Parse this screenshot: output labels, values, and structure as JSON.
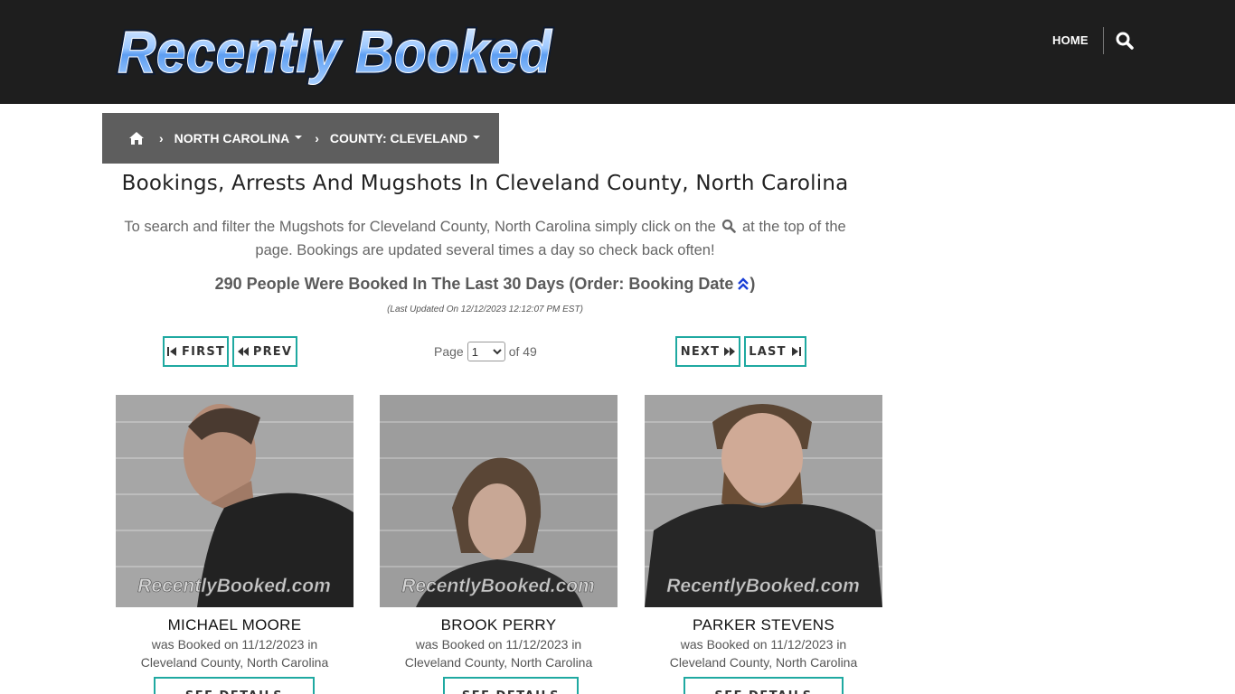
{
  "header": {
    "logo_text": "Recently Booked",
    "nav_home": "HOME",
    "search_icon": "search-icon"
  },
  "breadcrumb": {
    "home_icon": "home-icon",
    "items": [
      {
        "label": "NORTH CAROLINA"
      },
      {
        "label": "COUNTY: CLEVELAND"
      }
    ]
  },
  "main": {
    "title": "Bookings, Arrests And Mugshots In Cleveland County, North Carolina",
    "intro_before": "To search and filter the Mugshots for Cleveland County, North Carolina simply click on the",
    "intro_after": "at the top of the page. Bookings are updated several times a day so check back often!",
    "count_text": "290 People Were Booked In The Last 30 Days (Order: Booking Date",
    "count_close": ")",
    "last_updated": "(Last Updated On 12/12/2023 12:12:07 PM EST)"
  },
  "pagination": {
    "first": "FIRST",
    "prev": "PREV",
    "next": "NEXT",
    "last": "LAST",
    "page_label": "Page",
    "current_page": "1",
    "of_label": "of 49"
  },
  "cards": [
    {
      "name": "MICHAEL MOORE",
      "booked_line1": "was Booked on 11/12/2023 in",
      "booked_line2": "Cleveland County, North Carolina",
      "watermark": "RecentlyBooked.com",
      "button": "SEE DETAILS"
    },
    {
      "name": "BROOK PERRY",
      "booked_line1": "was Booked on 11/12/2023 in",
      "booked_line2": "Cleveland County, North Carolina",
      "watermark": "RecentlyBooked.com",
      "button": "SEE DETAILS"
    },
    {
      "name": "PARKER STEVENS",
      "booked_line1": "was Booked on 11/12/2023 in",
      "booked_line2": "Cleveland County, North Carolina",
      "watermark": "RecentlyBooked.com",
      "button": "SEE DETAILS"
    }
  ],
  "colors": {
    "header_bg": "#1e1e1e",
    "breadcrumb_bg": "#5e5e5e",
    "accent_teal": "#1fa9a1",
    "logo_blue": "#8fc3ff"
  }
}
